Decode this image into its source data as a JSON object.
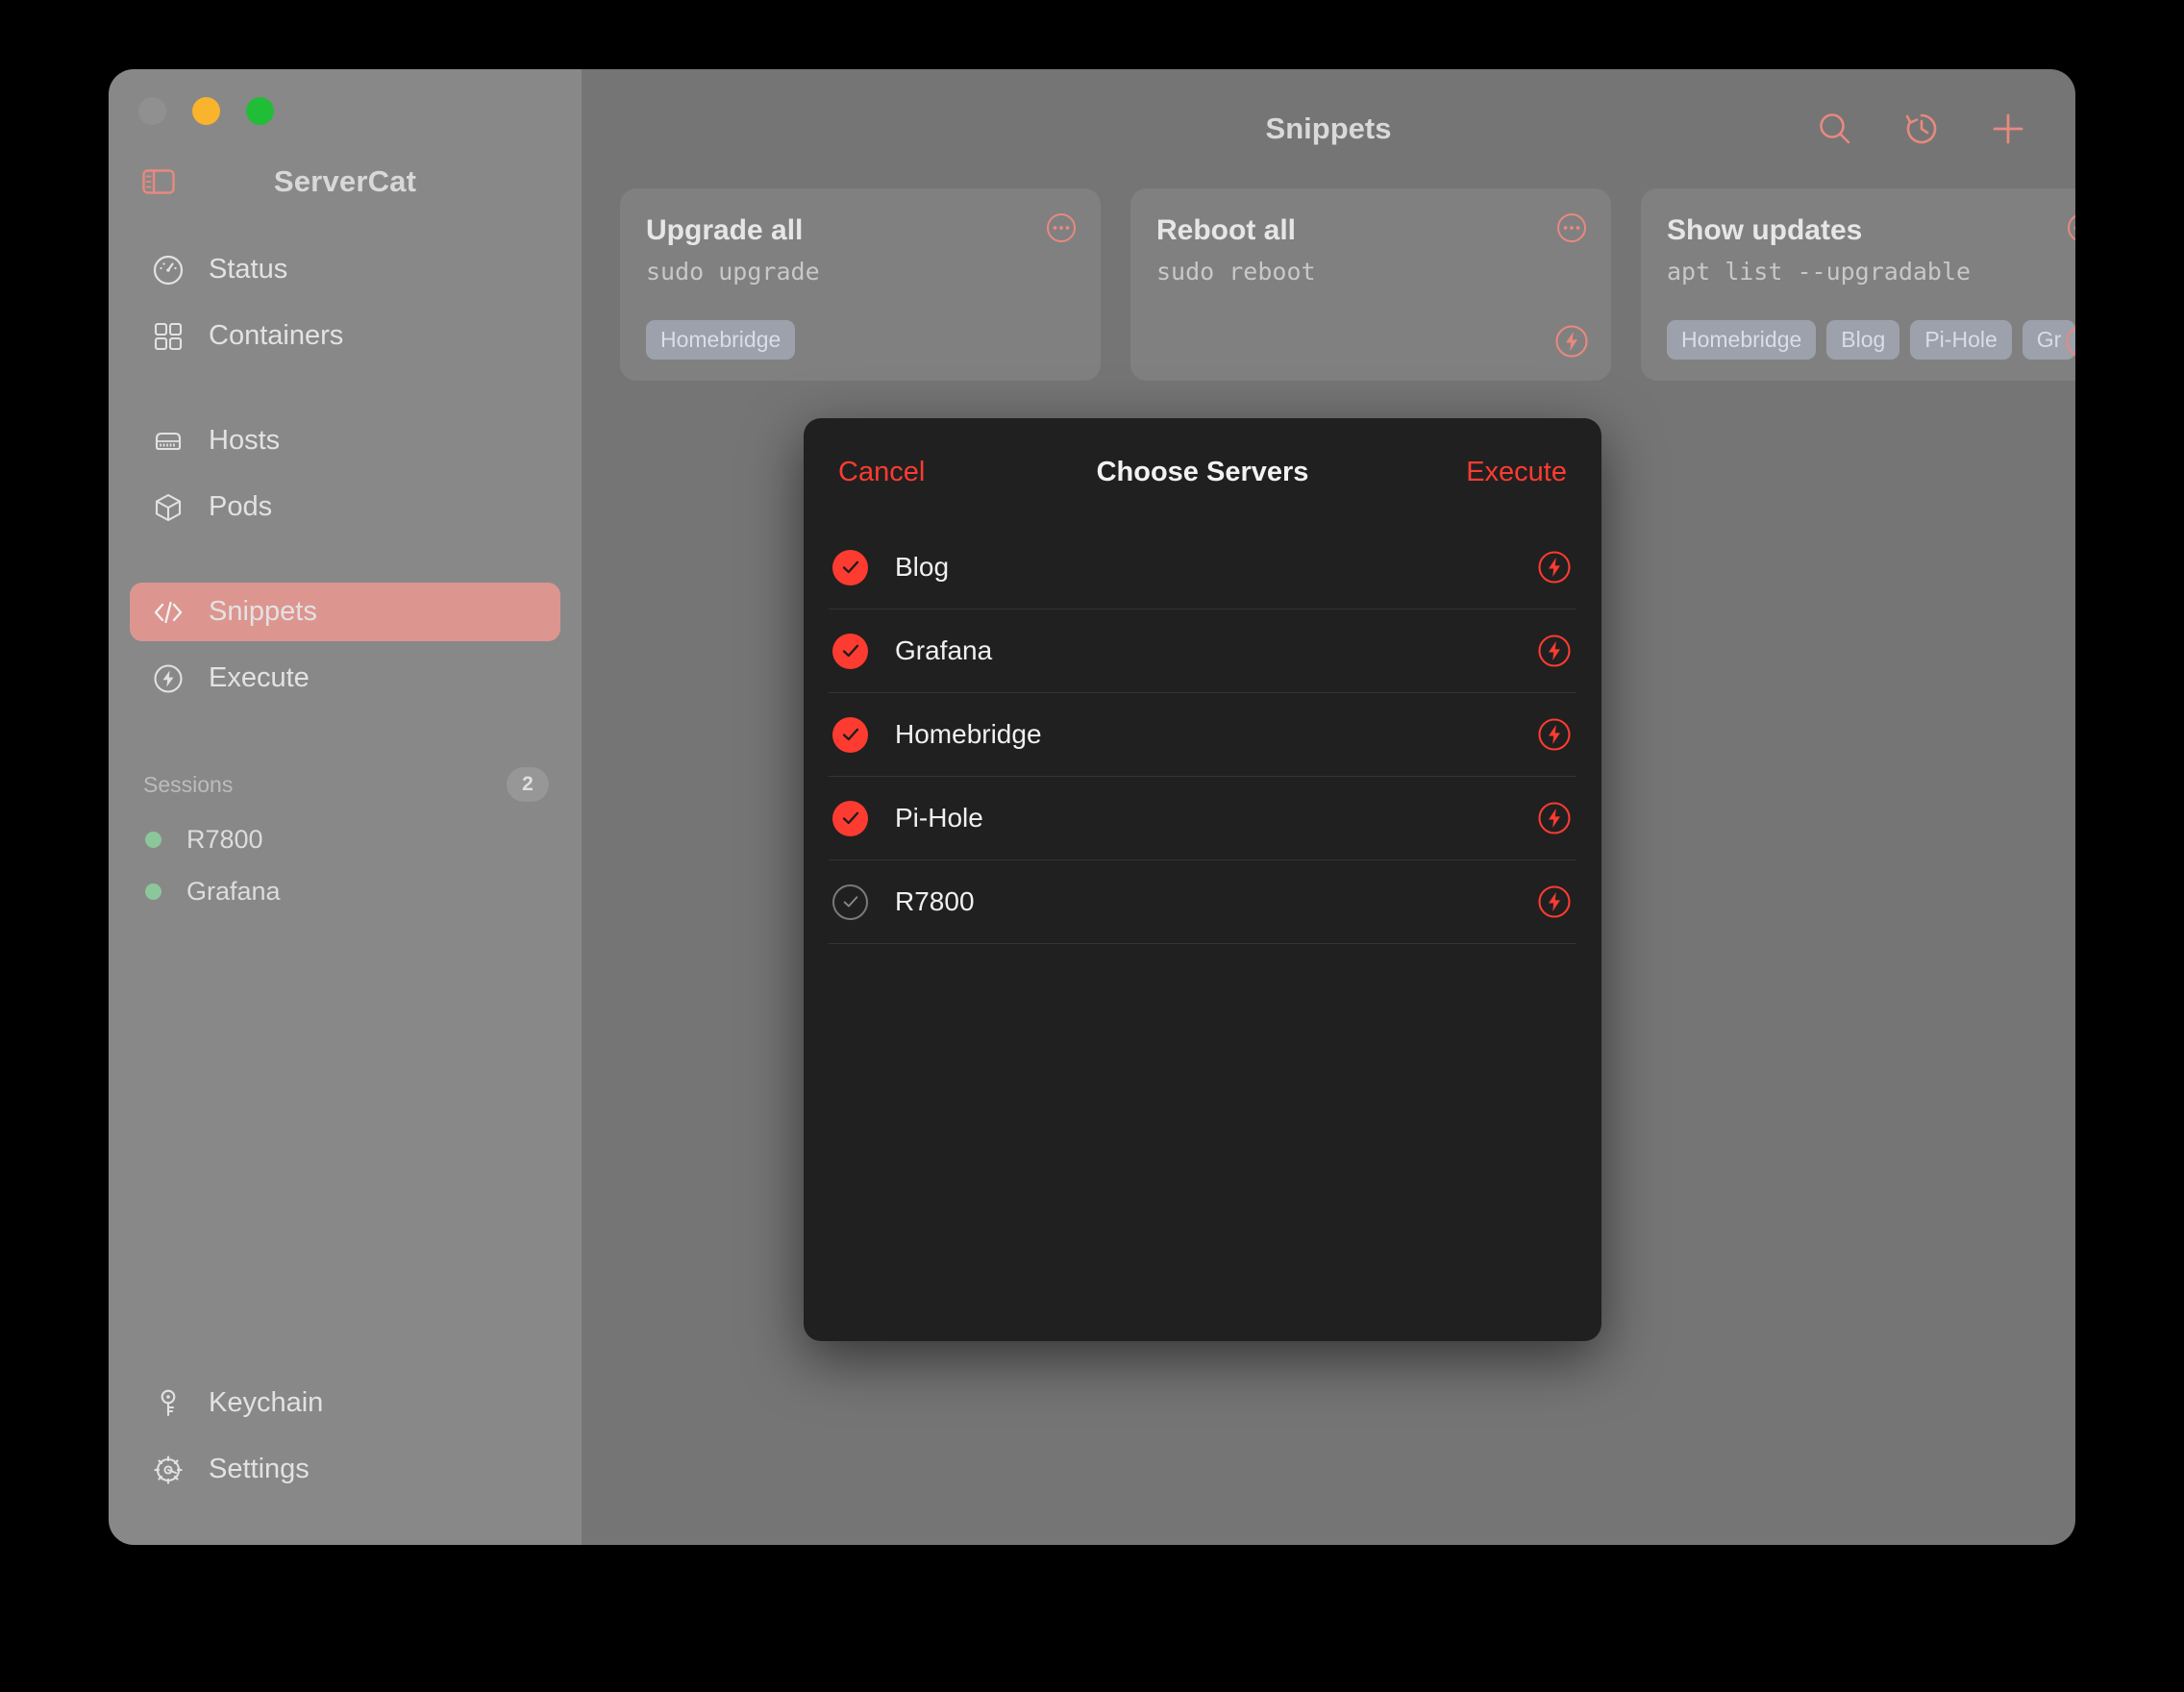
{
  "window": {
    "traffic_lights": [
      "close",
      "minimize",
      "maximize"
    ],
    "app_title": "ServerCat"
  },
  "sidebar": {
    "toggle_icon": "sidebar-toggle-icon",
    "nav": [
      {
        "label": "Status",
        "icon": "gauge-icon",
        "active": false
      },
      {
        "label": "Containers",
        "icon": "grid-squares-icon",
        "active": false
      },
      {
        "label": "Hosts",
        "icon": "server-rack-icon",
        "active": false
      },
      {
        "label": "Pods",
        "icon": "cube-box-icon",
        "active": false
      },
      {
        "label": "Snippets",
        "icon": "code-brackets-icon",
        "active": true
      },
      {
        "label": "Execute",
        "icon": "bolt-circle-icon",
        "active": false
      }
    ],
    "sessions": {
      "title": "Sessions",
      "count": "2",
      "items": [
        {
          "name": "R7800",
          "status_color": "#8bc79a"
        },
        {
          "name": "Grafana",
          "status_color": "#8bc79a"
        }
      ]
    },
    "bottom": [
      {
        "label": "Keychain",
        "icon": "key-icon"
      },
      {
        "label": "Settings",
        "icon": "gear-icon"
      }
    ]
  },
  "topbar": {
    "title": "Snippets",
    "actions": [
      {
        "name": "search-icon"
      },
      {
        "name": "history-clock-icon"
      },
      {
        "name": "plus-icon"
      }
    ]
  },
  "cards": [
    {
      "title": "Upgrade all",
      "command": "sudo upgrade",
      "tags": [
        "Homebridge"
      ],
      "more_icon": "ellipsis-circle-icon",
      "bolt_icon": "bolt-circle-icon"
    },
    {
      "title": "Reboot all",
      "command": "sudo reboot",
      "tags": [],
      "more_icon": "ellipsis-circle-icon",
      "bolt_icon": "bolt-circle-icon"
    },
    {
      "title": "Show updates",
      "command": "apt list --upgradable",
      "tags": [
        "Homebridge",
        "Blog",
        "Pi-Hole",
        "Gr"
      ],
      "more_icon": "ellipsis-circle-icon",
      "bolt_icon": "bolt-circle-icon"
    }
  ],
  "modal": {
    "cancel_label": "Cancel",
    "title": "Choose Servers",
    "execute_label": "Execute",
    "servers": [
      {
        "name": "Blog",
        "checked": true
      },
      {
        "name": "Grafana",
        "checked": true
      },
      {
        "name": "Homebridge",
        "checked": true
      },
      {
        "name": "Pi-Hole",
        "checked": true
      },
      {
        "name": "R7800",
        "checked": false
      }
    ]
  },
  "colors": {
    "accent_red": "#fd3b30",
    "accent_salmon": "#e8897f",
    "sidebar_bg": "#888888",
    "main_bg": "#757575",
    "modal_bg": "#202020",
    "active_item": "#dd9590",
    "session_green": "#8bc79a"
  }
}
